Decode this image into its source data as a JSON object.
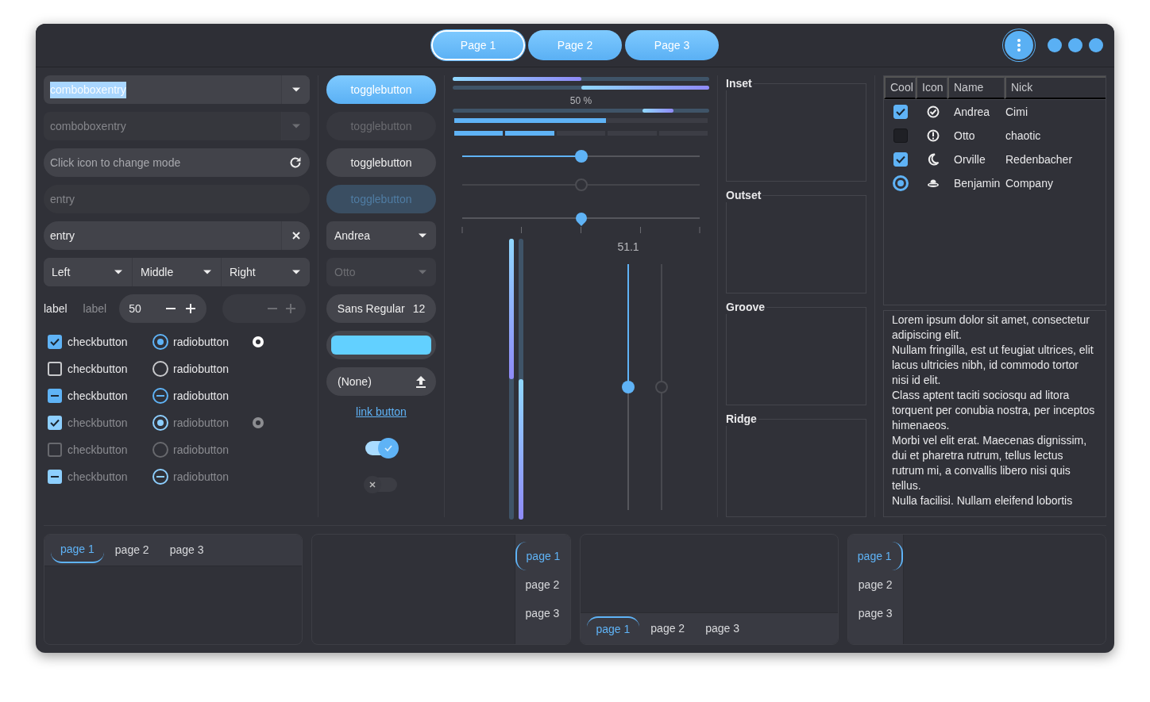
{
  "header": {
    "tabs": [
      {
        "label": "Page 1",
        "selected": true
      },
      {
        "label": "Page 2",
        "selected": false
      },
      {
        "label": "Page 3",
        "selected": false
      }
    ]
  },
  "entries": [
    {
      "kind": "combo",
      "text": "comboboxentry",
      "text_selected": true,
      "disabled": false
    },
    {
      "kind": "combo",
      "text": "comboboxentry",
      "text_selected": false,
      "disabled": true
    },
    {
      "kind": "icon-entry",
      "placeholder": "Click icon to change mode",
      "disabled": false
    },
    {
      "kind": "entry",
      "text": "entry",
      "disabled": true
    },
    {
      "kind": "clear-entry",
      "text": "entry",
      "disabled": false
    }
  ],
  "linked_combos": [
    {
      "value": "Left"
    },
    {
      "value": "Middle"
    },
    {
      "value": "Right"
    }
  ],
  "labels": [
    {
      "text": "label",
      "disabled": false
    },
    {
      "text": "label",
      "disabled": true
    }
  ],
  "spin_buttons": [
    {
      "value": "50",
      "disabled": false
    },
    {
      "disabled": true
    }
  ],
  "check_rows": [
    {
      "check": {
        "kind": "toggle",
        "label": "checkbutton",
        "checked": true,
        "disabled": false
      },
      "radio": {
        "kind": "toggle",
        "label": "radiobutton",
        "checked": true,
        "disabled": false
      },
      "extra_radio": {
        "checked": true,
        "disabled": false
      }
    },
    {
      "check": {
        "kind": "toggle",
        "label": "checkbutton",
        "checked": false,
        "disabled": false
      },
      "radio": {
        "kind": "toggle",
        "label": "radiobutton",
        "checked": false,
        "disabled": false
      }
    },
    {
      "check": {
        "kind": "mixed",
        "label": "checkbutton",
        "disabled": false
      },
      "radio": {
        "kind": "mixed",
        "label": "radiobutton",
        "disabled": false
      }
    },
    {
      "check": {
        "kind": "toggle",
        "label": "checkbutton",
        "checked": true,
        "disabled": true
      },
      "radio": {
        "kind": "toggle",
        "label": "radiobutton",
        "checked": true,
        "disabled": true
      },
      "extra_radio": {
        "checked": true,
        "disabled": true
      }
    },
    {
      "check": {
        "kind": "toggle",
        "label": "checkbutton",
        "checked": false,
        "disabled": true
      },
      "radio": {
        "kind": "toggle",
        "label": "radiobutton",
        "checked": false,
        "disabled": true
      }
    },
    {
      "check": {
        "kind": "mixed",
        "label": "checkbutton",
        "disabled": true
      },
      "radio": {
        "kind": "mixed",
        "label": "radiobutton",
        "disabled": true
      }
    }
  ],
  "toggle_buttons": [
    {
      "label": "togglebutton",
      "active": true,
      "disabled": false
    },
    {
      "label": "togglebutton",
      "active": false,
      "disabled": true
    },
    {
      "label": "togglebutton",
      "active": false,
      "disabled": false
    },
    {
      "label": "togglebutton",
      "active": true,
      "disabled": true
    }
  ],
  "combos": [
    {
      "value": "Andrea",
      "disabled": false
    },
    {
      "value": "Otto",
      "disabled": true
    }
  ],
  "font_button": {
    "family": "Sans Regular",
    "size": "12"
  },
  "color_button": {
    "color": "#62d0ff"
  },
  "file_button": {
    "label": "(None)"
  },
  "link_button": {
    "label": "link button"
  },
  "switches": [
    {
      "on": true
    },
    {
      "on": false
    }
  ],
  "progress_bars": [
    {
      "kind": "normal",
      "level": 0.5
    },
    {
      "kind": "inverted",
      "level": 0.5
    },
    {
      "kind": "pulse",
      "text": "50 %"
    }
  ],
  "level_bars": [
    {
      "kind": "continuous",
      "level": 0.6
    },
    {
      "kind": "discrete",
      "level": 0.4
    }
  ],
  "sliders": [
    {
      "kind": "fill",
      "level": 0.5,
      "disabled": false
    },
    {
      "kind": "fill",
      "level": 0.5,
      "disabled": true
    },
    {
      "kind": "marks",
      "level": 0.5,
      "disabled": false
    }
  ],
  "vertical_progress_bars": [
    {
      "kind": "normal",
      "level": 0.5
    },
    {
      "kind": "inverted",
      "level": 0.5
    }
  ],
  "vertical_sliders": [
    {
      "level": 0.5,
      "value": "51.1",
      "disabled": false
    },
    {
      "level": 0.5,
      "disabled": true
    }
  ],
  "frames": [
    "Inset",
    "Outset",
    "Groove",
    "Ridge"
  ],
  "tree": {
    "columns": [
      "Cool",
      "Icon",
      "Name",
      "Nick"
    ],
    "rows": [
      {
        "kind": "check",
        "checked": true,
        "name": "Andrea",
        "nick": "Cimi"
      },
      {
        "kind": "check",
        "checked": false,
        "name": "Otto",
        "nick": "chaotic"
      },
      {
        "kind": "check",
        "checked": true,
        "name": "Orville",
        "nick": "Redenbacher"
      },
      {
        "kind": "radio",
        "checked": true,
        "name": "Benjamin",
        "nick": "Company"
      }
    ]
  },
  "text_view": {
    "paragraphs": [
      "Lorem ipsum dolor sit amet, consectetur adipiscing elit.",
      "Nullam fringilla, est ut feugiat ultrices, elit lacus ultricies nibh, id commodo tortor nisi id elit.",
      "Class aptent taciti sociosqu ad litora torquent per conubia nostra, per inceptos himenaeos.",
      "Morbi vel elit erat. Maecenas dignissim, dui et pharetra rutrum, tellus lectus rutrum mi, a convallis libero nisi quis tellus.",
      "Nulla facilisi. Nullam eleifend lobortis"
    ]
  },
  "notebooks": [
    {
      "kind": "top",
      "tabs": [
        {
          "label": "page 1",
          "selected": true
        },
        {
          "label": "page 2",
          "selected": false
        },
        {
          "label": "page 3",
          "selected": false
        }
      ]
    },
    {
      "kind": "right",
      "tabs": [
        {
          "label": "page 1",
          "selected": true
        },
        {
          "label": "page 2",
          "selected": false
        },
        {
          "label": "page 3",
          "selected": false
        }
      ]
    },
    {
      "kind": "bottom",
      "tabs": [
        {
          "label": "page 1",
          "selected": true
        },
        {
          "label": "page 2",
          "selected": false
        },
        {
          "label": "page 3",
          "selected": false
        }
      ]
    },
    {
      "kind": "left",
      "tabs": [
        {
          "label": "page 1",
          "selected": true
        },
        {
          "label": "page 2",
          "selected": false
        },
        {
          "label": "page 3",
          "selected": false
        }
      ]
    }
  ]
}
